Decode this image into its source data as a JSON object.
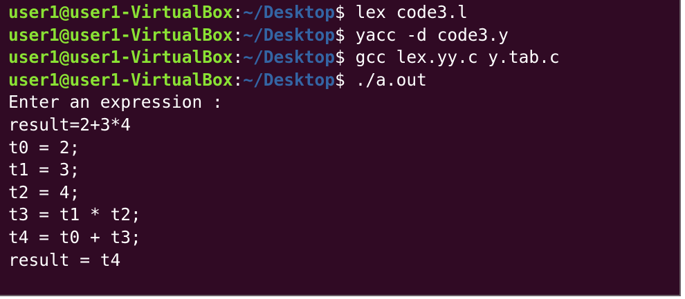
{
  "terminal": {
    "prompt": {
      "user_host": "user1@user1-VirtualBox",
      "colon": ":",
      "path": "~/Desktop",
      "dollar": "$ "
    },
    "commands": [
      "lex code3.l",
      "yacc -d code3.y",
      "gcc lex.yy.c y.tab.c",
      "./a.out"
    ],
    "output": [
      "Enter an expression :",
      "result=2+3*4",
      "t0 = 2;",
      "t1 = 3;",
      "t2 = 4;",
      "t3 = t1 * t2;",
      "t4 = t0 + t3;",
      "result = t4"
    ],
    "colors": {
      "background": "#300a24",
      "user_host": "#8ae234",
      "path": "#3465a4",
      "text": "#ffffff"
    }
  }
}
